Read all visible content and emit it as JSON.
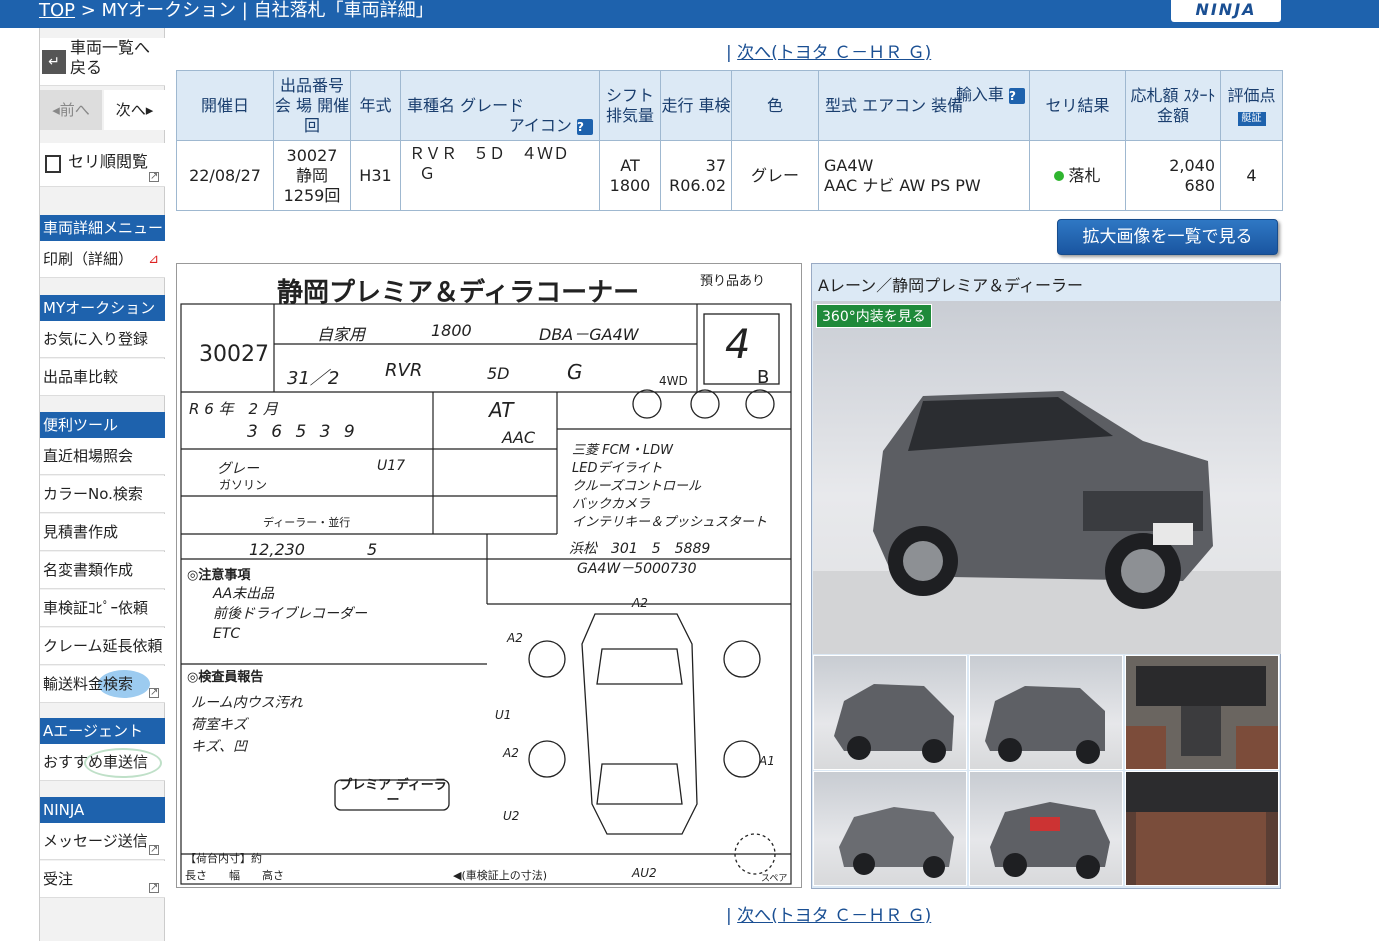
{
  "breadcrumb": {
    "top_link": "TOP",
    "path": " > MYオークション | 自社落札「車両詳細」"
  },
  "brand": "NINJA",
  "sidebar": {
    "back": "車両一覧へ戻る",
    "prev": "◂前へ",
    "next": "次へ▸",
    "seri_order": "セリ順閲覧",
    "sec_detail_menu": "車両詳細メニュー",
    "print": "印刷（詳細）",
    "sec_my_auction": "MYオークション",
    "favorite": "お気に入り登録",
    "compare": "出品車比較",
    "sec_tools": "便利ツール",
    "recent_price": "直近相場照会",
    "color_search": "カラーNo.検索",
    "estimate": "見積書作成",
    "name_change": "名変書類作成",
    "inspection_copy": "車検証ｺﾋﾟｰ依頼",
    "claim_extend": "クレーム延長依頼",
    "shipping_search": "輸送料金検索",
    "sec_agent": "Aエージェント",
    "recommend": "おすすめ車送信",
    "sec_ninja": "NINJA",
    "message": "メッセージ送信",
    "received": "受注"
  },
  "nav": {
    "next_label": "次へ(トヨタ Ｃ－ＨＲ Ｇ)"
  },
  "table": {
    "headers": {
      "date": "開催日",
      "lot": "出品番号 会 場 開催回",
      "year": "年式",
      "model_grade": "車種名 グレード",
      "icon": "アイコン",
      "shift": "シフト 排気量",
      "mileage": "走行 車検",
      "color": "色",
      "type": "型式 エアコン 装備",
      "import": "輸入車",
      "result": "セリ結果",
      "bid": "応札額 ｽﾀｰﾄ金額",
      "score": "評価点",
      "score_tag": "艇証"
    },
    "row": {
      "date": "22/08/27",
      "lot_no": "30027",
      "venue": "静岡",
      "session": "1259回",
      "year": "H31",
      "model": "ＲＶＲ　５Ｄ　４ＷＤ",
      "grade": "Ｇ",
      "shift": "AT",
      "cc": "1800",
      "mileage": "37",
      "shaken": "R06.02",
      "color": "グレー",
      "type": "GA4W",
      "equip": "AAC ナビ AW PS PW",
      "result": "落札",
      "bid": "2,040",
      "start": "680",
      "score": "4"
    }
  },
  "zoom_button": "拡大画像を一覧で見る",
  "sheet": {
    "title": "静岡プレミア＆ディラコーナー",
    "consign": "預り品あり",
    "lot": "30027",
    "usage": "自家用",
    "cc": "1800",
    "type": "DBA－GA4W",
    "score": "4",
    "interior": "B",
    "first_reg": "31／2",
    "name": "RVR",
    "doors": "5D",
    "grade": "G",
    "drive": "4WD",
    "shaken": "R 6 年　2 月",
    "mileage": "3 6 5 3 9",
    "shift": "AT",
    "ac": "AAC",
    "color": "グレー",
    "color_no": "U17",
    "fuel": "ガソリン",
    "import_kind": "ディーラー・並行",
    "recycle": "12,230",
    "capacity": "5",
    "reg_no": "浜松　301　5　5889",
    "chassis": "GA4W－5000730",
    "points": [
      "三菱 FCM・LDW",
      "LEDデイライト",
      "クルーズコントロール",
      "バックカメラ",
      "インテリキー＆プッシュスタート"
    ],
    "notes_title": "◎注意事項",
    "notes": [
      "AA未出品",
      "前後ドライブレコーダー",
      "ETC"
    ],
    "inspector_title": "◎検査員報告",
    "inspector": [
      "ルーム内ウス汚れ",
      "荷室キズ",
      "キズ、凹"
    ],
    "stamp": "プレミア ディーラー",
    "dims_label": "【荷台内寸】約",
    "footer_dims": "長さ　　幅　　高さ",
    "footer_note": "◀(車検証上の寸法)",
    "diagram_marks": [
      "A2",
      "A2",
      "U1",
      "A2",
      "A1",
      "U2",
      "AU2"
    ],
    "spare": "スペア"
  },
  "photos": {
    "header": "Aレーン／静岡プレミア＆ディーラー",
    "vr_button": "360°内装を見る"
  }
}
